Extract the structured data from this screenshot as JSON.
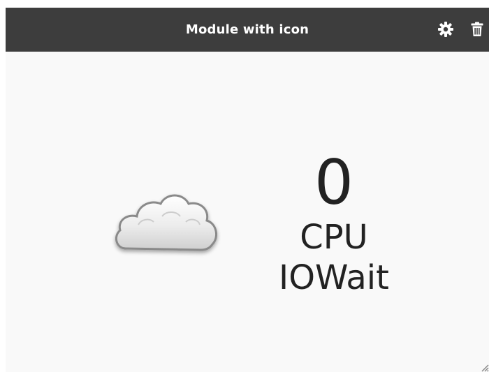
{
  "widget": {
    "title": "Module with icon",
    "value": "0",
    "label_line1": "CPU",
    "label_line2": "IOWait",
    "icon": "cloud-icon"
  },
  "toolbar": {
    "icons": [
      "gear-icon",
      "trash-icon"
    ]
  },
  "colors": {
    "titlebar_bg": "#3d3d3d",
    "titlebar_text": "#ffffff",
    "body_bg": "#f9f9f9",
    "value_text": "#222222"
  }
}
